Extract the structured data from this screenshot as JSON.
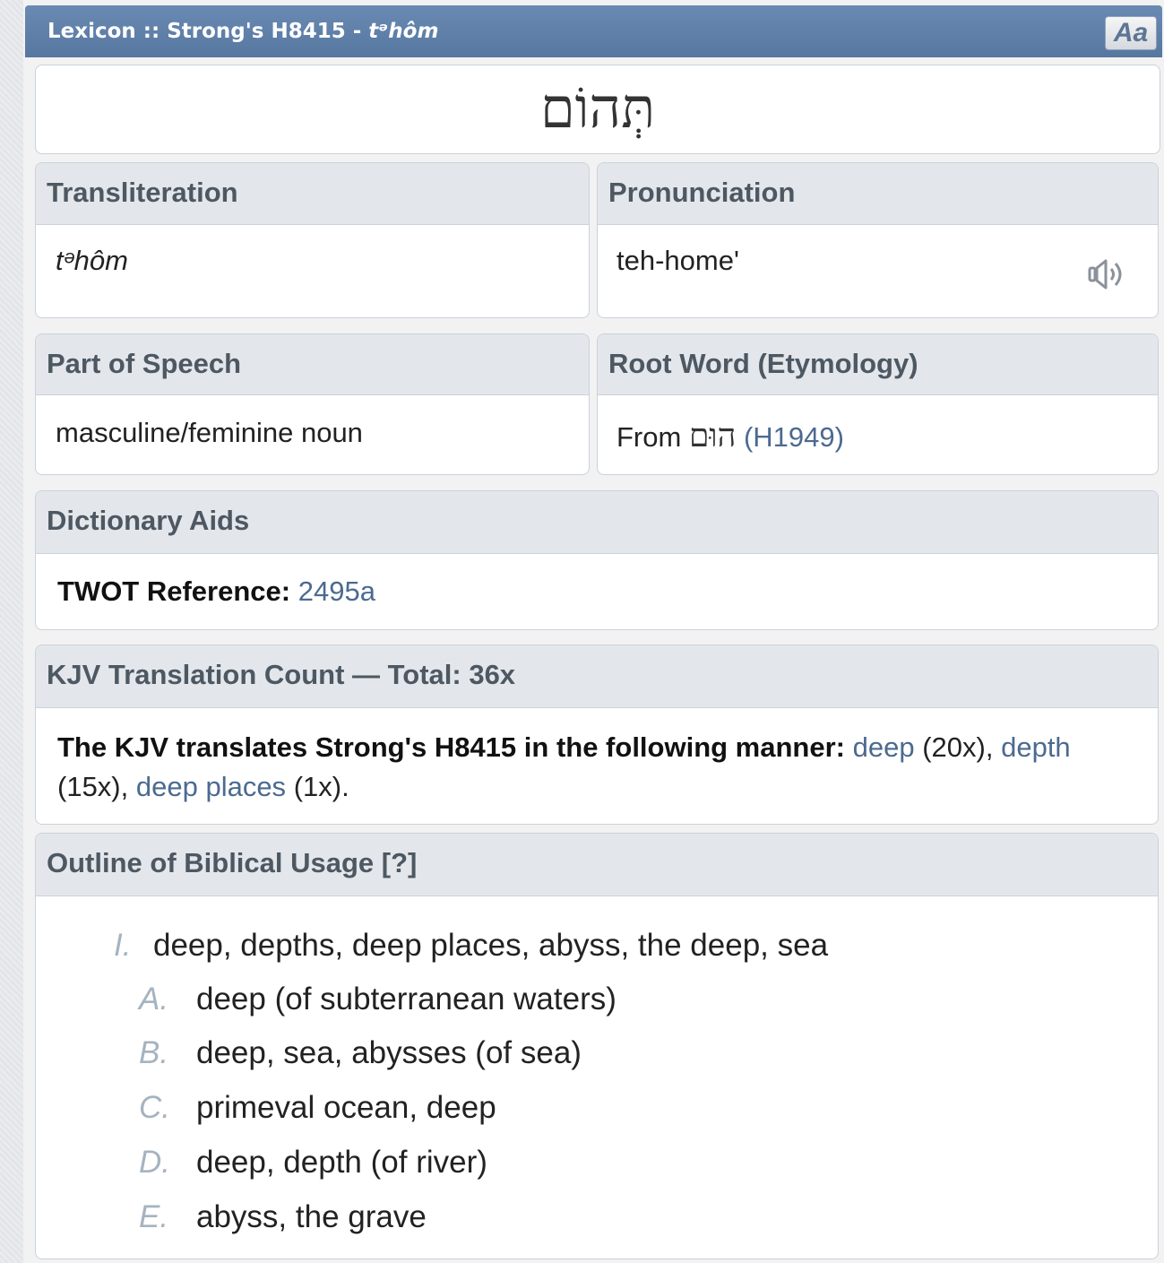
{
  "window": {
    "title_prefix": "Lexicon :: Strong's H8415 - ",
    "title_term": "tᵊhôm",
    "font_button": "Aa"
  },
  "headword": "תְּהוֹם",
  "transliteration": {
    "header": "Transliteration",
    "value": "tᵊhôm"
  },
  "pronunciation": {
    "header": "Pronunciation",
    "value": "teh-home'",
    "icon": "speaker-icon"
  },
  "part_of_speech": {
    "header": "Part of Speech",
    "value": "masculine/feminine noun"
  },
  "root_word": {
    "header": "Root Word (Etymology)",
    "prefix": "From ",
    "hebrew": "הוּם",
    "link": "(H1949)"
  },
  "dictionary_aids": {
    "header": "Dictionary Aids",
    "label": "TWOT Reference:",
    "value": "2495a"
  },
  "kjv": {
    "header": "KJV Translation Count — Total: 36x",
    "intro": "The KJV translates Strong's H8415 in the following manner:",
    "items": [
      {
        "word": "deep",
        "count": "(20x)"
      },
      {
        "word": "depth",
        "count": "(15x)"
      },
      {
        "word": "deep places",
        "count": "(1x)"
      }
    ]
  },
  "outline": {
    "header": "Outline of Biblical Usage [?]",
    "items": [
      {
        "marker": "I.",
        "text": "deep, depths, deep places, abyss, the deep, sea"
      },
      {
        "marker": "A.",
        "text": "deep (of subterranean waters)"
      },
      {
        "marker": "B.",
        "text": "deep, sea, abysses (of sea)"
      },
      {
        "marker": "C.",
        "text": "primeval ocean, deep"
      },
      {
        "marker": "D.",
        "text": "deep, depth (of river)"
      },
      {
        "marker": "E.",
        "text": "abyss, the grave"
      }
    ]
  },
  "colors": {
    "titlebar": "#5f7fa8",
    "link": "#4b6a90",
    "header_bg": "#e3e7eb",
    "header_text": "#4e5862",
    "outline_marker": "#a6b3c0"
  }
}
